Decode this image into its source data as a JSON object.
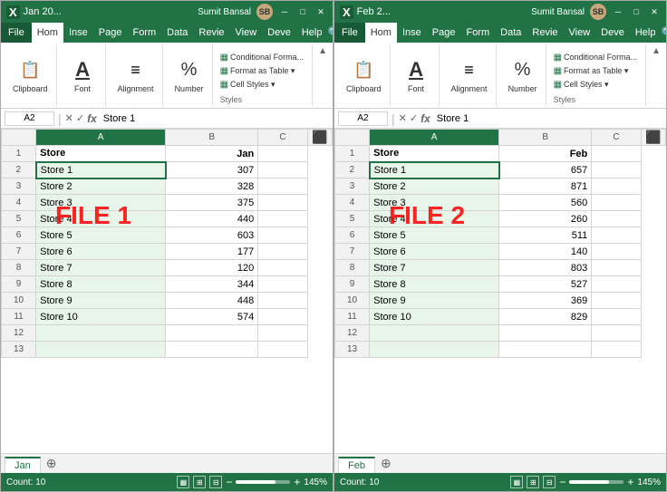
{
  "window1": {
    "title": "Jan 20...",
    "user": "Sumit Bansal",
    "file_label": "FILE 1",
    "sheet_tab": "Jan",
    "active_cell": "A2",
    "formula_value": "Store 1",
    "ribbon": {
      "tabs": [
        "File",
        "Hom",
        "Inse",
        "Page",
        "Form",
        "Data",
        "Revie",
        "View",
        "Deve",
        "Help"
      ],
      "active_tab": "Hom",
      "groups": {
        "clipboard": "Clipboard",
        "font": "Font",
        "alignment": "Alignment",
        "number": "Number",
        "styles": "Styles"
      },
      "styles_items": [
        "Conditional Forma...",
        "Format as Table ▾",
        "Cell Styles ▾"
      ]
    },
    "headers": [
      "Store",
      "Jan"
    ],
    "data": [
      [
        "Store 1",
        "307"
      ],
      [
        "Store 2",
        "328"
      ],
      [
        "Store 3",
        "375"
      ],
      [
        "Store 4",
        "440"
      ],
      [
        "Store 5",
        "603"
      ],
      [
        "Store 6",
        "177"
      ],
      [
        "Store 7",
        "120"
      ],
      [
        "Store 8",
        "344"
      ],
      [
        "Store 9",
        "448"
      ],
      [
        "Store 10",
        "574"
      ]
    ],
    "status": {
      "count_label": "Count: 10",
      "zoom": "145%"
    }
  },
  "window2": {
    "title": "Feb 2...",
    "user": "Sumit Bansal",
    "file_label": "FILE 2",
    "sheet_tab": "Feb",
    "active_cell": "A2",
    "formula_value": "Store 1",
    "ribbon": {
      "tabs": [
        "File",
        "Hom",
        "Inse",
        "Page",
        "Form",
        "Data",
        "Revie",
        "View",
        "Deve",
        "Help"
      ],
      "active_tab": "Hom",
      "styles_items": [
        "Conditional Forma...",
        "Format as Table ▾",
        "Cell Styles ▾"
      ]
    },
    "headers": [
      "Store",
      "Feb"
    ],
    "data": [
      [
        "Store 1",
        "657"
      ],
      [
        "Store 2",
        "871"
      ],
      [
        "Store 3",
        "560"
      ],
      [
        "Store 4",
        "260"
      ],
      [
        "Store 5",
        "511"
      ],
      [
        "Store 6",
        "140"
      ],
      [
        "Store 7",
        "803"
      ],
      [
        "Store 8",
        "527"
      ],
      [
        "Store 9",
        "369"
      ],
      [
        "Store 10",
        "829"
      ]
    ],
    "status": {
      "count_label": "Count: 10",
      "zoom": "145%"
    }
  },
  "icons": {
    "clipboard": "📋",
    "font": "A",
    "alignment": "≡",
    "number": "%",
    "search": "🔍",
    "expand": "▲",
    "check": "✓",
    "cross": "✗",
    "fx": "fx"
  }
}
